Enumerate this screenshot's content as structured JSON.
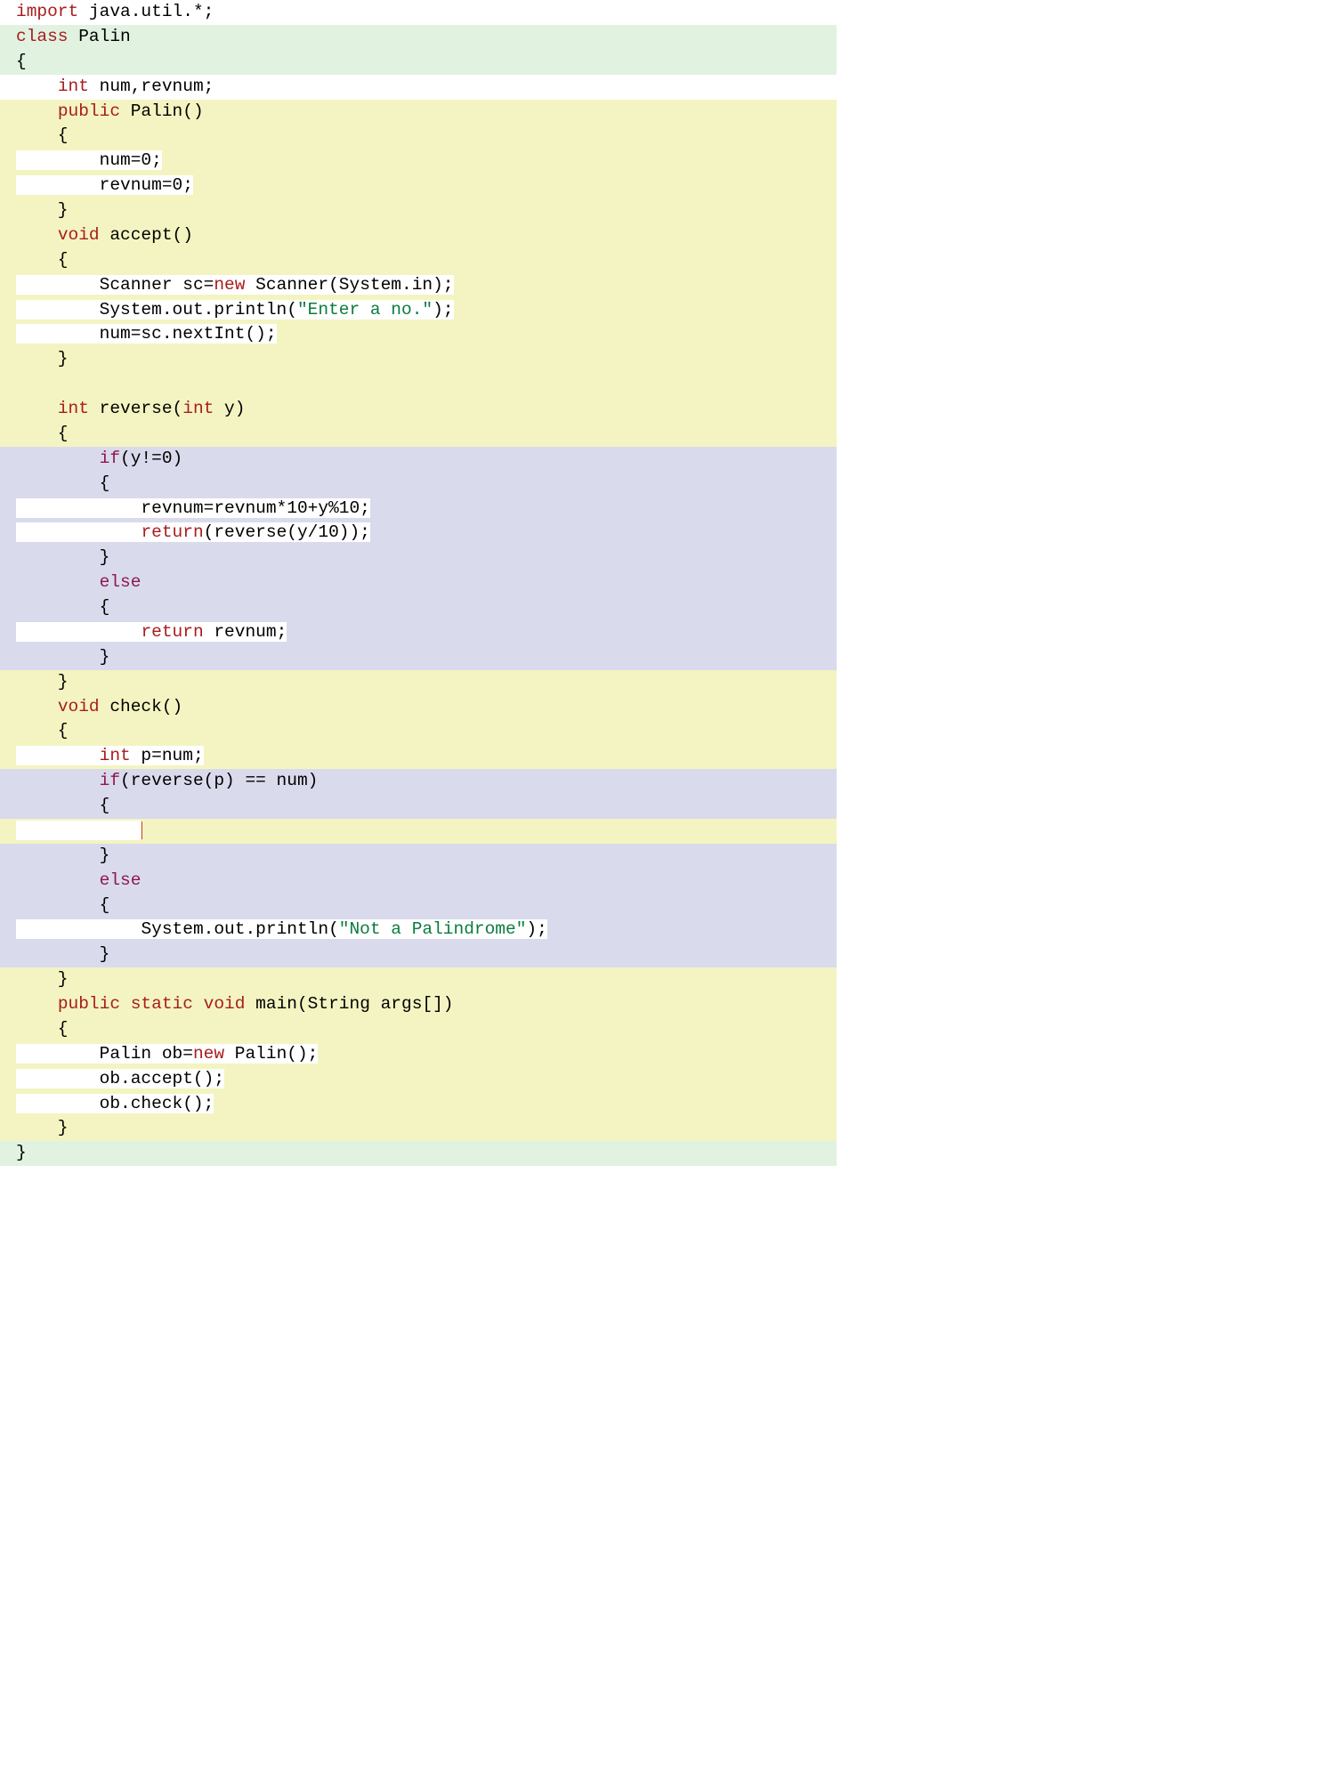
{
  "code": {
    "l1": {
      "import": "import",
      "pkg": " java.util.*;"
    },
    "l2": {
      "class": "class",
      "name": " Palin"
    },
    "l3": "{",
    "l4": {
      "pre": "    ",
      "int": "int",
      "rest": " num,revnum;"
    },
    "l5": {
      "pre": "    ",
      "public": "public",
      "rest": " Palin()"
    },
    "l6": "    {",
    "l7": "        num=0;",
    "l8": "        revnum=0;",
    "l9": "    }",
    "l10": {
      "pre": "    ",
      "void": "void",
      "rest": " accept()"
    },
    "l11": "    {",
    "l12": {
      "pre": "        ",
      "a": "Scanner sc=",
      "new": "new",
      "b": " Scanner(System.in);"
    },
    "l13": {
      "pre": "        ",
      "a": "System.out.println(",
      "s": "\"Enter a no.\"",
      "b": ");"
    },
    "l14": "        num=sc.nextInt();",
    "l15": "    }",
    "l16": "    ",
    "l17": {
      "pre": "    ",
      "int": "int",
      "a": " reverse(",
      "int2": "int",
      "b": " y)"
    },
    "l18": "    {",
    "l19": {
      "pre": "        ",
      "if": "if",
      "rest": "(y!=0)"
    },
    "l20": "        {",
    "l21": "            revnum=revnum*10+y%10;",
    "l22": {
      "pre": "            ",
      "return": "return",
      "rest": "(reverse(y/10));"
    },
    "l23": "        }",
    "l24": {
      "pre": "        ",
      "else": "else"
    },
    "l25": "        {",
    "l26": {
      "pre": "            ",
      "return": "return",
      "rest": " revnum;"
    },
    "l27": "        }",
    "l28": "    }",
    "l29": {
      "pre": "    ",
      "void": "void",
      "rest": " check()"
    },
    "l30": "    {",
    "l31": {
      "pre": "        ",
      "int": "int",
      "rest": " p=num;"
    },
    "l32": {
      "pre": "        ",
      "if": "if",
      "rest": "(reverse(p) == num)"
    },
    "l33": "        {",
    "l34": "            ",
    "l35": "        }",
    "l36": {
      "pre": "        ",
      "else": "else"
    },
    "l37": "        {",
    "l38": {
      "pre": "            ",
      "a": "System.out.println(",
      "s": "\"Not a Palindrome\"",
      "b": ");"
    },
    "l39": "        }",
    "l40": "    }",
    "l41": {
      "pre": "    ",
      "public": "public",
      "sp1": " ",
      "static": "static",
      "sp2": " ",
      "void": "void",
      "rest": " main(String args[])"
    },
    "l42": "    {",
    "l43": {
      "pre": "        ",
      "a": "Palin ob=",
      "new": "new",
      "b": " Palin();"
    },
    "l44": "        ob.accept();",
    "l45": "        ob.check();",
    "l46": "    }",
    "l47": "}"
  }
}
